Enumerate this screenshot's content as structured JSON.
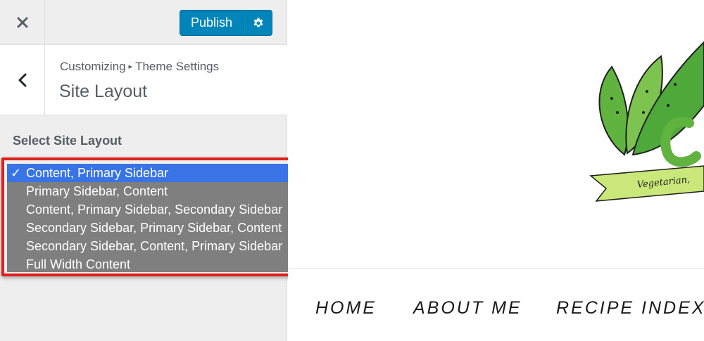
{
  "toolbar": {
    "close_icon": "close-icon",
    "publish_label": "Publish",
    "settings_icon": "gear-icon",
    "accent_color": "#0085ba"
  },
  "section": {
    "back_icon": "chevron-left-icon",
    "breadcrumb_parent": "Customizing",
    "breadcrumb_separator": "▸",
    "breadcrumb_current": "Theme Settings",
    "title": "Site Layout"
  },
  "control": {
    "label": "Select Site Layout",
    "check_mark": "✓",
    "selected_index": 0,
    "options": [
      "Content, Primary Sidebar",
      "Primary Sidebar, Content",
      "Content, Primary Sidebar, Secondary Sidebar",
      "Secondary Sidebar, Primary Sidebar, Content",
      "Secondary Sidebar, Content, Primary Sidebar",
      "Full Width Content"
    ],
    "highlight_color": "#e0211b",
    "selected_color": "#3874e6"
  },
  "preview": {
    "tagline": "Vegetarian,",
    "nav": [
      "HOME",
      "ABOUT ME",
      "RECIPE INDEX"
    ]
  }
}
